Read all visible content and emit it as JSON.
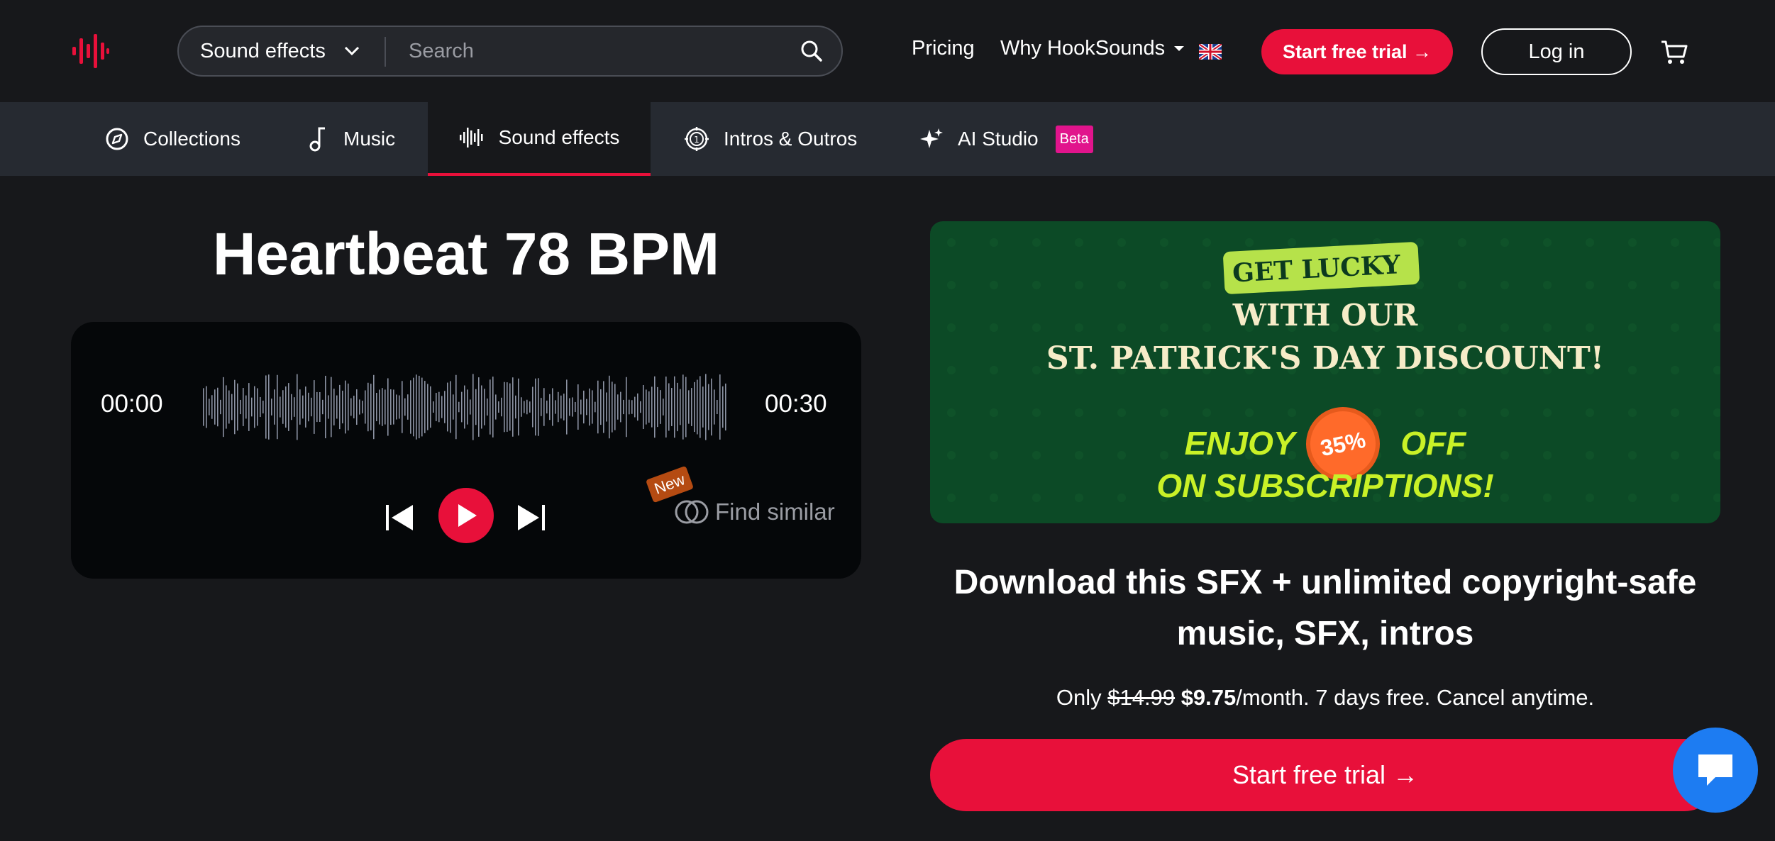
{
  "header": {
    "search_category": "Sound effects",
    "search_placeholder": "Search",
    "nav_pricing": "Pricing",
    "nav_why": "Why HookSounds",
    "trial_label": "Start free trial →",
    "login_label": "Log in"
  },
  "category_nav": {
    "items": [
      {
        "label": "Collections",
        "icon": "compass-icon"
      },
      {
        "label": "Music",
        "icon": "music-note-icon"
      },
      {
        "label": "Sound effects",
        "icon": "waveform-icon",
        "active": true
      },
      {
        "label": "Intros & Outros",
        "icon": "film-reel-icon"
      },
      {
        "label": "AI Studio",
        "icon": "sparkle-icon",
        "badge": "Beta"
      }
    ]
  },
  "track": {
    "title": "Heartbeat 78 BPM",
    "current_time": "00:00",
    "duration": "00:30",
    "new_badge": "New",
    "find_similar": "Find similar"
  },
  "promo": {
    "line1": "Get Lucky",
    "line2": "WITH OUR",
    "line3": "ST. PATRICK'S DAY DISCOUNT!",
    "enjoy": "ENJOY",
    "percent": "35%",
    "off": "OFF",
    "line5": "ON SUBSCRIPTIONS!"
  },
  "cta": {
    "heading_line1": "Download this SFX + unlimited copyright-safe",
    "heading_line2": "music, SFX, intros",
    "price_prefix": "Only",
    "price_old": "$14.99",
    "price_new": "$9.75",
    "price_suffix": "/month. 7 days free. Cancel anytime.",
    "button_label": "Start free trial →"
  },
  "colors": {
    "background": "#17181b",
    "accent": "#e8103a",
    "nav_bar": "#262a31",
    "player_bg": "#050709",
    "promo_bg": "#0c4a26",
    "chat": "#1d7cf2"
  }
}
